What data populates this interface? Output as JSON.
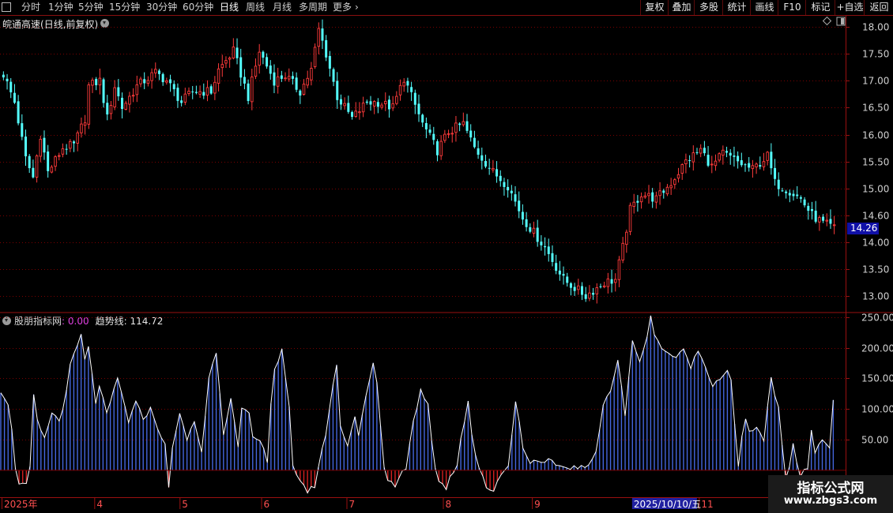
{
  "toolbar": {
    "periods": [
      "分时",
      "1分钟",
      "5分钟",
      "15分钟",
      "30分钟",
      "60分钟",
      "日线",
      "周线",
      "月线",
      "多周期",
      "更多"
    ],
    "active_period": "日线",
    "right_buttons": [
      "复权",
      "叠加",
      "多股",
      "统计",
      "画线",
      "F10",
      "标记",
      "+自选",
      "返回"
    ]
  },
  "stock": {
    "name": "皖通高速",
    "mode": "(日线,前复权)",
    "current_price": "14.26"
  },
  "indicator": {
    "name": "股朋指标网",
    "value": ": 0.00",
    "trend_label": "趋势线: 114.72"
  },
  "colors": {
    "up": "#ff3b3b",
    "down": "#54ffff",
    "grid": "#7a0000",
    "axis_text": "#d0d0d0",
    "bar_blue": "#4466dd",
    "bar_red": "#d42020",
    "trend_line": "#ffffff",
    "price_tag_bg": "#1010a8",
    "date_highlight_bg": "#2020a0"
  },
  "icons": [
    "chevron-down-icon",
    "diamond-icon",
    "window-icon",
    "chevron-right-icon"
  ],
  "x_axis": {
    "labels": [
      {
        "text": "2025年",
        "index": 0
      },
      {
        "text": "4",
        "index": 25
      },
      {
        "text": "5",
        "index": 48
      },
      {
        "text": "6",
        "index": 70
      },
      {
        "text": "7",
        "index": 93
      },
      {
        "text": "8",
        "index": 119
      },
      {
        "text": "9",
        "index": 143
      },
      {
        "text": "11",
        "index": 188
      }
    ],
    "highlight": {
      "text": "2025/10/10/五",
      "index": 170
    }
  },
  "watermark": {
    "line1": "指标公式网",
    "line2": "www.zbgs3.com"
  },
  "chart_data": [
    {
      "type": "candlestick",
      "ylim": [
        12.72,
        18.15
      ],
      "y_ticks": [
        13.0,
        13.5,
        14.0,
        14.5,
        15.0,
        15.5,
        16.0,
        16.5,
        17.0,
        17.5,
        18.0
      ],
      "y_tick_labels": [
        "13.00",
        "13.50",
        "14.00",
        "14.60",
        "15.00",
        "15.50",
        "16.00",
        "16.50",
        "17.00",
        "17.50",
        "18.00"
      ],
      "n_bars": 225,
      "anchors": [
        [
          0,
          17.12
        ],
        [
          3,
          16.6
        ],
        [
          6,
          15.55
        ],
        [
          8,
          15.2
        ],
        [
          10,
          16.0
        ],
        [
          12,
          15.3
        ],
        [
          16,
          15.75
        ],
        [
          19,
          15.8
        ],
        [
          22,
          16.3
        ],
        [
          23,
          16.9
        ],
        [
          26,
          17.0
        ],
        [
          28,
          16.3
        ],
        [
          30,
          16.9
        ],
        [
          32,
          16.5
        ],
        [
          36,
          16.9
        ],
        [
          41,
          17.15
        ],
        [
          44,
          17.0
        ],
        [
          48,
          16.6
        ],
        [
          51,
          16.8
        ],
        [
          56,
          16.8
        ],
        [
          58,
          17.2
        ],
        [
          62,
          17.55
        ],
        [
          66,
          16.7
        ],
        [
          69,
          17.55
        ],
        [
          73,
          17.0
        ],
        [
          76,
          17.1
        ],
        [
          80,
          16.8
        ],
        [
          83,
          17.2
        ],
        [
          85,
          17.95
        ],
        [
          87,
          17.5
        ],
        [
          90,
          16.7
        ],
        [
          94,
          16.3
        ],
        [
          98,
          16.6
        ],
        [
          101,
          16.6
        ],
        [
          105,
          16.5
        ],
        [
          108,
          17.05
        ],
        [
          113,
          16.2
        ],
        [
          117,
          15.7
        ],
        [
          120,
          16.05
        ],
        [
          124,
          16.2
        ],
        [
          127,
          15.75
        ],
        [
          132,
          15.3
        ],
        [
          136,
          15.05
        ],
        [
          140,
          14.45
        ],
        [
          146,
          13.9
        ],
        [
          151,
          13.3
        ],
        [
          157,
          13.0
        ],
        [
          162,
          13.25
        ],
        [
          165,
          13.3
        ],
        [
          167,
          13.9
        ],
        [
          169,
          14.6
        ],
        [
          172,
          14.9
        ],
        [
          176,
          14.8
        ],
        [
          180,
          15.1
        ],
        [
          184,
          15.5
        ],
        [
          188,
          15.72
        ],
        [
          191,
          15.4
        ],
        [
          194,
          15.65
        ],
        [
          199,
          15.45
        ],
        [
          202,
          15.35
        ],
        [
          206,
          15.6
        ],
        [
          208,
          15.1
        ],
        [
          212,
          14.95
        ],
        [
          215,
          14.8
        ],
        [
          218,
          14.5
        ],
        [
          221,
          14.35
        ],
        [
          224,
          14.26
        ]
      ]
    },
    {
      "type": "bar",
      "ylim": [
        -44,
        255
      ],
      "y_ticks": [
        50,
        100,
        150,
        200,
        250
      ],
      "y_tick_labels": [
        "50.00",
        "100.00",
        "150.00",
        "200.00",
        "250.00"
      ],
      "last_value": 114.72,
      "anchors": [
        [
          0,
          130
        ],
        [
          2,
          110
        ],
        [
          3,
          65
        ],
        [
          4,
          5
        ],
        [
          5,
          -20
        ],
        [
          7,
          -25
        ],
        [
          8,
          5
        ],
        [
          9,
          120
        ],
        [
          10,
          80
        ],
        [
          12,
          50
        ],
        [
          14,
          95
        ],
        [
          16,
          80
        ],
        [
          17,
          100
        ],
        [
          19,
          170
        ],
        [
          22,
          220
        ],
        [
          23,
          180
        ],
        [
          24,
          200
        ],
        [
          26,
          110
        ],
        [
          27,
          140
        ],
        [
          29,
          90
        ],
        [
          32,
          150
        ],
        [
          35,
          80
        ],
        [
          37,
          110
        ],
        [
          39,
          85
        ],
        [
          41,
          100
        ],
        [
          43,
          70
        ],
        [
          45,
          40
        ],
        [
          46,
          -30
        ],
        [
          47,
          40
        ],
        [
          49,
          90
        ],
        [
          51,
          50
        ],
        [
          53,
          80
        ],
        [
          55,
          30
        ],
        [
          57,
          150
        ],
        [
          59,
          195
        ],
        [
          61,
          60
        ],
        [
          63,
          120
        ],
        [
          65,
          35
        ],
        [
          66,
          100
        ],
        [
          68,
          90
        ],
        [
          69,
          55
        ],
        [
          72,
          40
        ],
        [
          73,
          15
        ],
        [
          74,
          110
        ],
        [
          75,
          165
        ],
        [
          77,
          195
        ],
        [
          79,
          100
        ],
        [
          80,
          5
        ],
        [
          82,
          -15
        ],
        [
          84,
          -35
        ],
        [
          86,
          -25
        ],
        [
          87,
          5
        ],
        [
          89,
          60
        ],
        [
          91,
          140
        ],
        [
          92,
          170
        ],
        [
          93,
          75
        ],
        [
          95,
          40
        ],
        [
          97,
          90
        ],
        [
          98,
          55
        ],
        [
          100,
          120
        ],
        [
          102,
          175
        ],
        [
          103,
          140
        ],
        [
          104,
          75
        ],
        [
          105,
          5
        ],
        [
          106,
          -15
        ],
        [
          108,
          -25
        ],
        [
          109,
          -10
        ],
        [
          111,
          5
        ],
        [
          113,
          80
        ],
        [
          115,
          130
        ],
        [
          117,
          110
        ],
        [
          118,
          50
        ],
        [
          119,
          5
        ],
        [
          120,
          -15
        ],
        [
          122,
          -30
        ],
        [
          123,
          -10
        ],
        [
          125,
          5
        ],
        [
          126,
          50
        ],
        [
          127,
          80
        ],
        [
          128,
          115
        ],
        [
          129,
          60
        ],
        [
          130,
          25
        ],
        [
          131,
          5
        ],
        [
          133,
          -25
        ],
        [
          135,
          -35
        ],
        [
          137,
          -5
        ],
        [
          139,
          5
        ],
        [
          141,
          115
        ],
        [
          142,
          80
        ],
        [
          143,
          35
        ],
        [
          145,
          15
        ],
        [
          148,
          10
        ],
        [
          150,
          15
        ],
        [
          154,
          5
        ],
        [
          158,
          5
        ],
        [
          161,
          5
        ],
        [
          163,
          30
        ],
        [
          165,
          110
        ],
        [
          167,
          130
        ],
        [
          169,
          180
        ],
        [
          171,
          90
        ],
        [
          173,
          210
        ],
        [
          175,
          180
        ],
        [
          177,
          215
        ],
        [
          178,
          250
        ],
        [
          179,
          225
        ],
        [
          181,
          200
        ],
        [
          183,
          190
        ],
        [
          185,
          185
        ],
        [
          187,
          195
        ],
        [
          189,
          170
        ],
        [
          191,
          195
        ],
        [
          193,
          170
        ],
        [
          195,
          140
        ],
        [
          197,
          150
        ],
        [
          199,
          165
        ],
        [
          200,
          145
        ],
        [
          202,
          5
        ],
        [
          203,
          55
        ],
        [
          204,
          80
        ],
        [
          205,
          65
        ],
        [
          207,
          70
        ],
        [
          209,
          50
        ],
        [
          211,
          150
        ],
        [
          212,
          120
        ],
        [
          213,
          100
        ],
        [
          214,
          40
        ],
        [
          215,
          -10
        ],
        [
          216,
          5
        ],
        [
          217,
          40
        ],
        [
          219,
          -10
        ],
        [
          221,
          5
        ],
        [
          222,
          65
        ],
        [
          223,
          30
        ],
        [
          225,
          50
        ],
        [
          227,
          40
        ],
        [
          228,
          114.72
        ]
      ]
    }
  ]
}
